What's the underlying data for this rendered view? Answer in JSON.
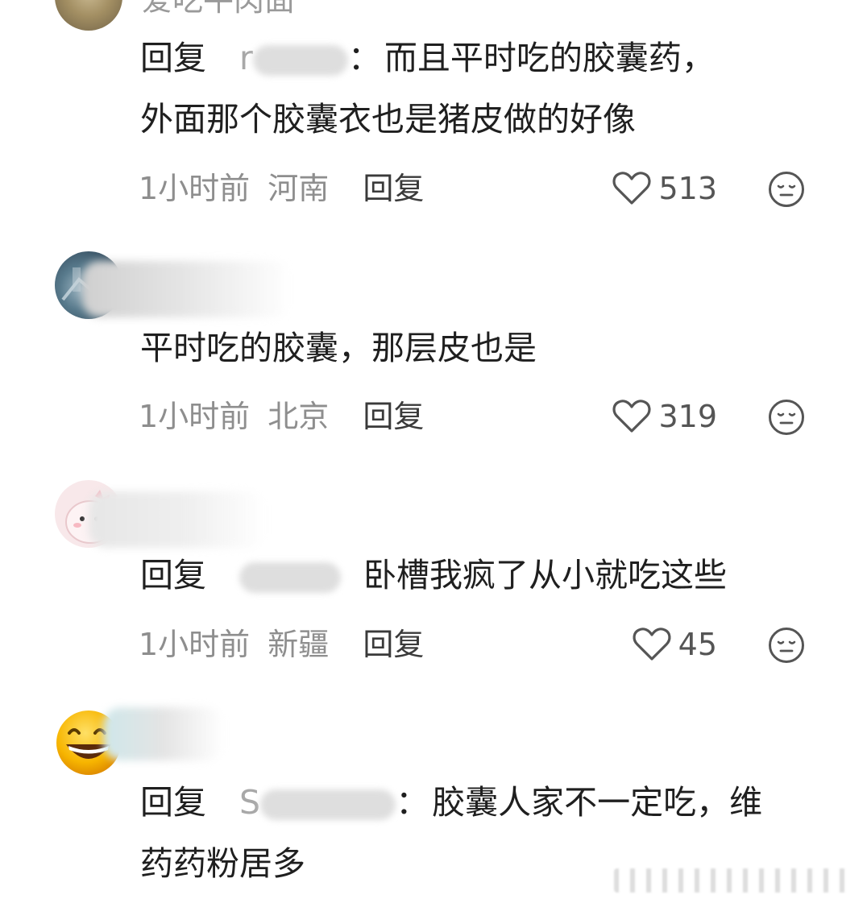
{
  "comments": [
    {
      "name_visible": "爱吃牛肉面",
      "reply_prefix": "回复",
      "mention_visible": "r",
      "mention_tail": "：",
      "line1": "而且平时吃的胶囊药，",
      "line2": "外面那个胶囊衣也是猪皮做的好像",
      "time": "1小时前",
      "location": "河南",
      "reply_label": "回复",
      "likes": "513"
    },
    {
      "line1": "平时吃的胶囊，那层皮也是",
      "time": "1小时前",
      "location": "北京",
      "reply_label": "回复",
      "likes": "319"
    },
    {
      "name_visible": "m",
      "reply_prefix": "回复",
      "line1": "卧槽我疯了从小就吃这些",
      "time": "1小时前",
      "location": "新疆",
      "reply_label": "回复",
      "likes": "45"
    },
    {
      "reply_prefix": "回复",
      "mention_visible": "S",
      "mention_tail": "：",
      "line1": "胶囊人家不一定吃，维",
      "line2": "药药粉居多"
    }
  ],
  "icons": {
    "like": "heart-outline-icon",
    "dislike": "neutral-face-icon"
  },
  "colors": {
    "text": "#1f1f1f",
    "meta": "#8e8e8e",
    "background": "#ffffff"
  }
}
